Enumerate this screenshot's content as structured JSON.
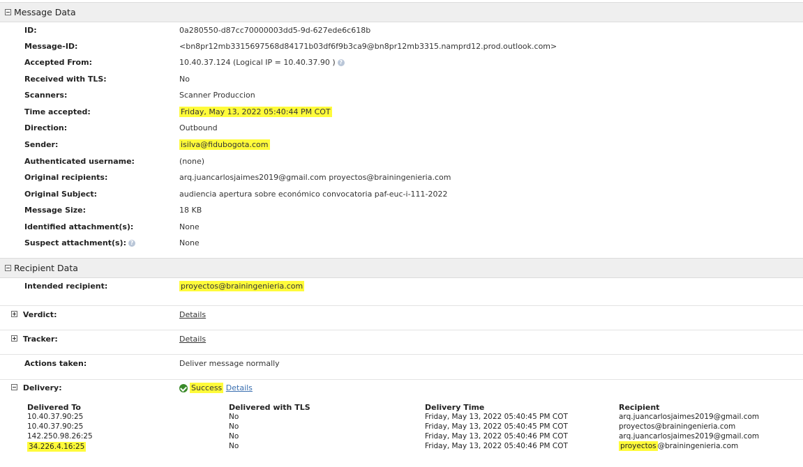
{
  "message_data": {
    "title": "Message Data",
    "rows": [
      {
        "label": "ID:",
        "value": "0a280550-d87cc70000003dd5-9d-627ede6c618b"
      },
      {
        "label": "Message-ID:",
        "value": "<bn8pr12mb3315697568d84171b03df6f9b3ca9@bn8pr12mb3315.namprd12.prod.outlook.com>"
      },
      {
        "label": "Accepted From:",
        "value": "10.40.37.124 (Logical IP =  10.40.37.90 )"
      },
      {
        "label": "Received with TLS:",
        "value": "No"
      },
      {
        "label": "Scanners:",
        "value": "Scanner Produccion"
      },
      {
        "label": "Time accepted:",
        "value": "Friday, May 13, 2022 05:40:44 PM COT"
      },
      {
        "label": "Direction:",
        "value": "Outbound"
      },
      {
        "label": "Sender:",
        "value": "isilva@fidubogota.com"
      },
      {
        "label": "Authenticated username:",
        "value": "(none)"
      },
      {
        "label": "Original recipients:",
        "value": "arq.juancarlosjaimes2019@gmail.com  proyectos@brainingenieria.com"
      },
      {
        "label": "Original Subject:",
        "value": "audiencia apertura sobre económico convocatoria paf-euc-i-111-2022"
      },
      {
        "label": "Message Size:",
        "value": "18 KB"
      },
      {
        "label": "Identified attachment(s):",
        "value": "None"
      },
      {
        "label": "Suspect attachment(s):",
        "value": "None"
      }
    ]
  },
  "recipient_data": {
    "title": "Recipient Data",
    "intended_label": "Intended recipient:",
    "intended_value": "proyectos@brainingenieria.com",
    "verdict_label": "Verdict:",
    "verdict_link": "Details",
    "tracker_label": "Tracker:",
    "tracker_link": "Details",
    "actions_label": "Actions taken:",
    "actions_value": "Deliver message normally",
    "delivery_label": "Delivery:",
    "delivery_status": "Success",
    "delivery_link": "Details"
  },
  "delivery_table": {
    "headers": [
      "Delivered To",
      "Delivered with TLS",
      "Delivery Time",
      "Recipient"
    ],
    "rows": [
      [
        "10.40.37.90:25",
        "No",
        "Friday, May 13, 2022 05:40:45 PM COT",
        "arq.juancarlosjaimes2019@gmail.com"
      ],
      [
        "10.40.37.90:25",
        "No",
        "Friday, May 13, 2022 05:40:45 PM COT",
        "proyectos@brainingenieria.com"
      ],
      [
        "142.250.98.26:25",
        "No",
        "Friday, May 13, 2022 05:40:46 PM COT",
        "arq.juancarlosjaimes2019@gmail.com"
      ],
      [
        "34.226.4.16:25",
        "No",
        "Friday, May 13, 2022 05:40:46 PM COT",
        "proyectos@brainingenieria.com"
      ]
    ],
    "last_recipient_highlight": "proyectos",
    "last_recipient_rest": "@brainingenieria.com"
  },
  "colors": {
    "highlight": "#fffb3a",
    "link": "#3a6fb0",
    "success": "#3a8a2a"
  },
  "help_glyph": "?"
}
